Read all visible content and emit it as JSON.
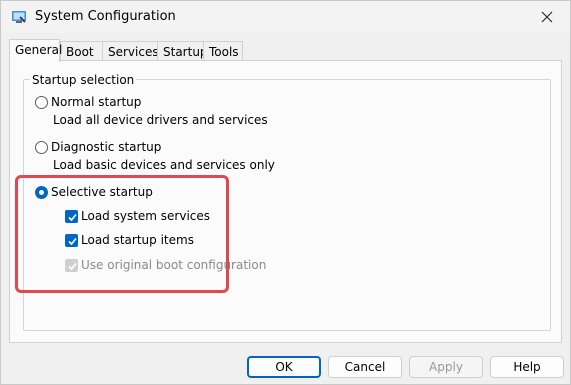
{
  "window": {
    "title": "System Configuration",
    "accent_color": "#0067c0",
    "highlight_color": "#e0484f"
  },
  "tabs": [
    {
      "label": "General",
      "active": true
    },
    {
      "label": "Boot",
      "active": false
    },
    {
      "label": "Services",
      "active": false
    },
    {
      "label": "Startup",
      "active": false
    },
    {
      "label": "Tools",
      "active": false
    }
  ],
  "startup": {
    "group_label": "Startup selection",
    "normal": {
      "label": "Normal startup",
      "description": "Load all device drivers and services",
      "selected": false
    },
    "diagnostic": {
      "label": "Diagnostic startup",
      "description": "Load basic devices and services only",
      "selected": false
    },
    "selective": {
      "label": "Selective startup",
      "selected": true,
      "options": [
        {
          "label": "Load system services",
          "checked": true,
          "enabled": true
        },
        {
          "label": "Load startup items",
          "checked": true,
          "enabled": true
        },
        {
          "label": "Use original boot configuration",
          "checked": true,
          "enabled": false
        }
      ]
    }
  },
  "buttons": {
    "ok": "OK",
    "cancel": "Cancel",
    "apply": "Apply",
    "help": "Help"
  },
  "icons": {
    "app": "msconfig-icon",
    "close": "close-icon",
    "check": "checkmark-icon"
  }
}
